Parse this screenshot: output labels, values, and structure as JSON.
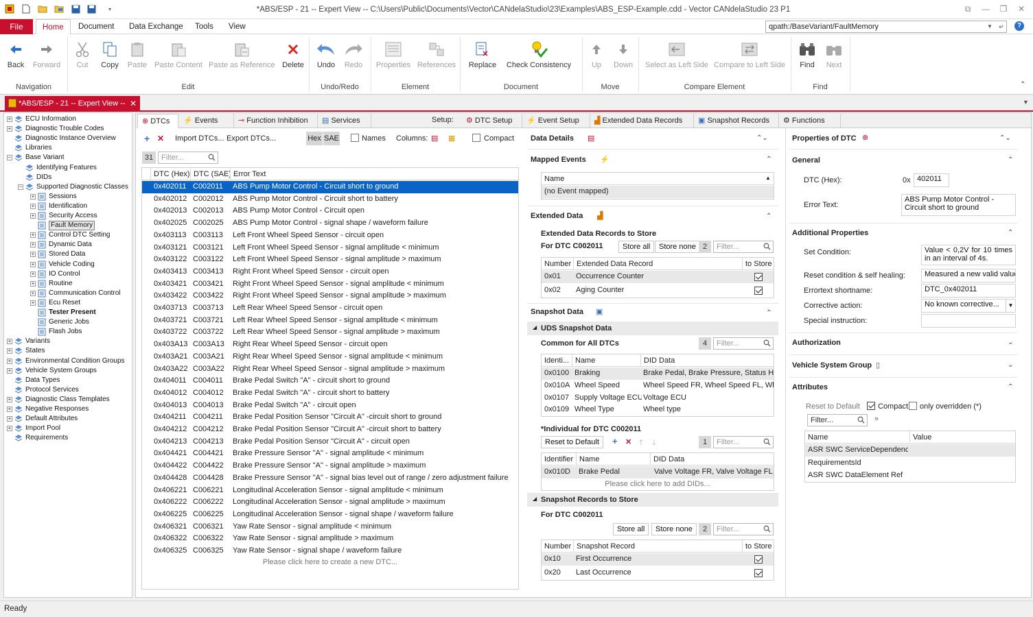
{
  "window": {
    "title": "*ABS/ESP - 21 -- Expert View -- C:\\Users\\Public\\Documents\\Vector\\CANdelaStudio\\23\\Examples\\ABS_ESP-Example.cdd - Vector CANdelaStudio 23 P1"
  },
  "menu": {
    "file": "File",
    "tabs": [
      "Home",
      "Document",
      "Data Exchange",
      "Tools",
      "View"
    ],
    "qpath": "qpath:/BaseVariant/FaultMemory"
  },
  "ribbon": {
    "buttons": {
      "back": "Back",
      "forward": "Forward",
      "cut": "Cut",
      "copy": "Copy",
      "paste": "Paste",
      "paste_content": "Paste Content",
      "paste_ref": "Paste as Reference",
      "delete": "Delete",
      "undo": "Undo",
      "redo": "Redo",
      "properties": "Properties",
      "references": "References",
      "replace": "Replace",
      "check": "Check Consistency",
      "up": "Up",
      "down": "Down",
      "select_left": "Select as Left Side",
      "compare_left": "Compare to Left Side",
      "find": "Find",
      "next": "Next"
    },
    "groups": [
      "Navigation",
      "Edit",
      "Undo/Redo",
      "Element",
      "Document",
      "Move",
      "Compare Element",
      "Find"
    ]
  },
  "doc_tab": "*ABS/ESP - 21 -- Expert View --",
  "tree": [
    {
      "label": "ECU Information",
      "level": 0,
      "exp": "+"
    },
    {
      "label": "Diagnostic Trouble Codes",
      "level": 0,
      "exp": "+"
    },
    {
      "label": "Diagnostic Instance Overview",
      "level": 0,
      "exp": ""
    },
    {
      "label": "Libraries",
      "level": 0,
      "exp": ""
    },
    {
      "label": "Base Variant",
      "level": 0,
      "exp": "-"
    },
    {
      "label": "Identifying Features",
      "level": 1,
      "exp": ""
    },
    {
      "label": "DIDs",
      "level": 1,
      "exp": ""
    },
    {
      "label": "Supported Diagnostic Classes",
      "level": 1,
      "exp": "-"
    },
    {
      "label": "Sessions",
      "level": 2,
      "exp": "+"
    },
    {
      "label": "Identification",
      "level": 2,
      "exp": "+"
    },
    {
      "label": "Security Access",
      "level": 2,
      "exp": "+"
    },
    {
      "label": "Fault Memory",
      "level": 2,
      "exp": "",
      "sel": true
    },
    {
      "label": "Control DTC Setting",
      "level": 2,
      "exp": "+"
    },
    {
      "label": "Dynamic Data",
      "level": 2,
      "exp": "+"
    },
    {
      "label": "Stored Data",
      "level": 2,
      "exp": "+"
    },
    {
      "label": "Vehicle Coding",
      "level": 2,
      "exp": "+"
    },
    {
      "label": "IO Control",
      "level": 2,
      "exp": "+"
    },
    {
      "label": "Routine",
      "level": 2,
      "exp": "+"
    },
    {
      "label": "Communication Control",
      "level": 2,
      "exp": "+"
    },
    {
      "label": "Ecu Reset",
      "level": 2,
      "exp": "+"
    },
    {
      "label": "Tester Present",
      "level": 2,
      "exp": "",
      "bold": true
    },
    {
      "label": "Generic Jobs",
      "level": 2,
      "exp": ""
    },
    {
      "label": "Flash Jobs",
      "level": 2,
      "exp": ""
    },
    {
      "label": "Variants",
      "level": 0,
      "exp": "+"
    },
    {
      "label": "States",
      "level": 0,
      "exp": "+"
    },
    {
      "label": "Environmental Condition Groups",
      "level": 0,
      "exp": "+"
    },
    {
      "label": "Vehicle System Groups",
      "level": 0,
      "exp": "+"
    },
    {
      "label": "Data Types",
      "level": 0,
      "exp": ""
    },
    {
      "label": "Protocol Services",
      "level": 0,
      "exp": ""
    },
    {
      "label": "Diagnostic Class Templates",
      "level": 0,
      "exp": "+"
    },
    {
      "label": "Negative Responses",
      "level": 0,
      "exp": "+"
    },
    {
      "label": "Default Attributes",
      "level": 0,
      "exp": "+"
    },
    {
      "label": "Import Pool",
      "level": 0,
      "exp": "+"
    },
    {
      "label": "Requirements",
      "level": 0,
      "exp": ""
    }
  ],
  "tabs": {
    "dtcs": "DTCs",
    "events": "Events",
    "inhibition": "Function Inhibition",
    "services": "Services",
    "setup": "Setup:",
    "dtc_setup": "DTC Setup",
    "event_setup": "Event Setup",
    "edr": "Extended Data Records",
    "snapshot": "Snapshot Records",
    "functions": "Functions"
  },
  "dtc_toolbar": {
    "import": "Import DTCs...",
    "export": "Export DTCs...",
    "hex": "Hex",
    "sae": "SAE",
    "names": "Names",
    "columns": "Columns:",
    "compact": "Compact",
    "count": "31",
    "filter": "Filter..."
  },
  "dtc_table": {
    "headers": [
      "DTC (Hex)",
      "DTC (SAE)",
      "Error Text"
    ],
    "rows": [
      [
        "0x402011",
        "C002011",
        "ABS Pump Motor Control - Circuit short to ground"
      ],
      [
        "0x402012",
        "C002012",
        "ABS Pump Motor Control - Circuit short to battery"
      ],
      [
        "0x402013",
        "C002013",
        "ABS Pump Motor Control - Circuit open"
      ],
      [
        "0x402025",
        "C002025",
        "ABS Pump Motor Control - signal shape / waveform failure"
      ],
      [
        "0x403113",
        "C003113",
        "Left Front Wheel Speed Sensor - circuit open"
      ],
      [
        "0x403121",
        "C003121",
        "Left Front Wheel Speed Sensor - signal amplitude < minimum"
      ],
      [
        "0x403122",
        "C003122",
        "Left Front Wheel Speed Sensor - signal amplitude > maximum"
      ],
      [
        "0x403413",
        "C003413",
        "Right Front Wheel Speed Sensor - circuit open"
      ],
      [
        "0x403421",
        "C003421",
        "Right Front Wheel Speed Sensor - signal amplitude < minimum"
      ],
      [
        "0x403422",
        "C003422",
        "Right Front Wheel Speed Sensor - signal amplitude > maximum"
      ],
      [
        "0x403713",
        "C003713",
        "Left Rear Wheel Speed Sensor - circuit open"
      ],
      [
        "0x403721",
        "C003721",
        "Left Rear Wheel Speed Sensor - signal amplitude < minimum"
      ],
      [
        "0x403722",
        "C003722",
        "Left Rear Wheel Speed Sensor - signal amplitude > maximum"
      ],
      [
        "0x403A13",
        "C003A13",
        "Right Rear Wheel Speed Sensor - circuit open"
      ],
      [
        "0x403A21",
        "C003A21",
        "Right Rear Wheel Speed Sensor - signal amplitude < minimum"
      ],
      [
        "0x403A22",
        "C003A22",
        "Right Rear Wheel Speed Sensor - signal amplitude > maximum"
      ],
      [
        "0x404011",
        "C004011",
        "Brake Pedal Switch \"A\" - circuit short to ground"
      ],
      [
        "0x404012",
        "C004012",
        "Brake Pedal Switch \"A\" - circuit short to battery"
      ],
      [
        "0x404013",
        "C004013",
        "Brake Pedal Switch \"A\" - circuit open"
      ],
      [
        "0x404211",
        "C004211",
        "Brake Pedal Position Sensor \"Circuit A\" -circuit short to ground"
      ],
      [
        "0x404212",
        "C004212",
        "Brake Pedal Position Sensor \"Circuit A\" -circuit short to battery"
      ],
      [
        "0x404213",
        "C004213",
        "Brake Pedal Position Sensor \"Circuit A\" - circuit open"
      ],
      [
        "0x404421",
        "C004421",
        "Brake Pressure Sensor \"A\" - signal amplitude < minimum"
      ],
      [
        "0x404422",
        "C004422",
        "Brake Pressure Sensor \"A\" - signal amplitude > maximum"
      ],
      [
        "0x404428",
        "C004428",
        "Brake Pressure Sensor \"A\" - signal bias level out of range / zero adjustment failure"
      ],
      [
        "0x406221",
        "C006221",
        "Longitudinal Acceleration Sensor - signal amplitude < minimum"
      ],
      [
        "0x406222",
        "C006222",
        "Longitudinal Acceleration Sensor - signal amplitude > maximum"
      ],
      [
        "0x406225",
        "C006225",
        "Longitudinal Acceleration Sensor - signal shape / waveform failure"
      ],
      [
        "0x406321",
        "C006321",
        "Yaw Rate Sensor - signal amplitude < minimum"
      ],
      [
        "0x406322",
        "C006322",
        "Yaw Rate Sensor - signal amplitude > maximum"
      ],
      [
        "0x406325",
        "C006325",
        "Yaw Rate Sensor - signal shape / waveform failure"
      ]
    ],
    "new_row": "Please click here to create a new DTC..."
  },
  "details": {
    "title": "Data Details",
    "mapped_events": {
      "title": "Mapped Events",
      "header": "Name",
      "row": "(no Event mapped)"
    },
    "extended": {
      "title": "Extended Data",
      "sub": "Extended Data Records to Store",
      "for_dtc": "For DTC C002011",
      "store_all": "Store all",
      "store_none": "Store none",
      "count": "2",
      "filter": "Filter...",
      "headers": [
        "Number",
        "Extended Data Record",
        "to Store"
      ],
      "rows": [
        [
          "0x01",
          "Occurrence Counter"
        ],
        [
          "0x02",
          "Aging Counter"
        ]
      ]
    },
    "snapshot": {
      "title": "Snapshot Data",
      "uds": "UDS Snapshot Data",
      "common": "Common for All DTCs",
      "common_count": "4",
      "filter": "Filter...",
      "common_headers": [
        "Identi...",
        "Name",
        "DID Data"
      ],
      "common_rows": [
        [
          "0x0100",
          "Braking",
          "Brake Pedal, Brake Pressure, Status Hyd"
        ],
        [
          "0x010A",
          "Wheel Speed",
          "Wheel Speed FR, Wheel Speed FL, Whee"
        ],
        [
          "0x0107",
          "Supply Voltage ECU",
          "Voltage ECU"
        ],
        [
          "0x0109",
          "Wheel Type",
          "Wheel type"
        ]
      ],
      "individual": "*Individual for DTC C002011",
      "reset": "Reset to Default",
      "ind_count": "1",
      "ind_headers": [
        "Identifier",
        "Name",
        "DID Data"
      ],
      "ind_rows": [
        [
          "0x010D",
          "Brake Pedal",
          "Valve Voltage FR, Valve Voltage FL, V"
        ]
      ],
      "add_did": "Please click here to add DIDs...",
      "records_title": "Snapshot Records to Store",
      "records_for": "For DTC C002011",
      "store_all": "Store all",
      "store_none": "Store none",
      "rec_count": "2",
      "rec_headers": [
        "Number",
        "Snapshot Record",
        "to Store"
      ],
      "rec_rows": [
        [
          "0x10",
          "First Occurrence"
        ],
        [
          "0x20",
          "Last Occurrence"
        ]
      ]
    }
  },
  "props": {
    "title": "Properties of DTC",
    "general": "General",
    "dtc_hex_label": "DTC (Hex):",
    "dtc_prefix": "0x",
    "dtc_hex": "402011",
    "error_text_label": "Error Text:",
    "error_text": "ABS Pump Motor Control - Circuit short to ground",
    "additional": "Additional Properties",
    "set_condition_label": "Set Condition:",
    "set_condition": "Value < 0,2V for 10 times in an interval of 4s.",
    "reset_label": "Reset condition & self healing:",
    "reset_value": "Measured a new valid value",
    "shortname_label": "Errortext shortname:",
    "shortname": "DTC_0x402011",
    "corrective_label": "Corrective action:",
    "corrective": "No known corrective...",
    "special_label": "Special instruction:",
    "authorization": "Authorization",
    "vsg": "Vehicle System Group",
    "attributes": "Attributes",
    "reset_default": "Reset to Default",
    "compact": "Compact",
    "only_overridden": "only overridden (*)",
    "filter": "Filter...",
    "attr_headers": [
      "Name",
      "Value"
    ],
    "attr_rows": [
      "ASR SWC ServiceDependenc...",
      "RequirementsId",
      "ASR SWC DataElement Ref"
    ]
  },
  "status": "Ready"
}
